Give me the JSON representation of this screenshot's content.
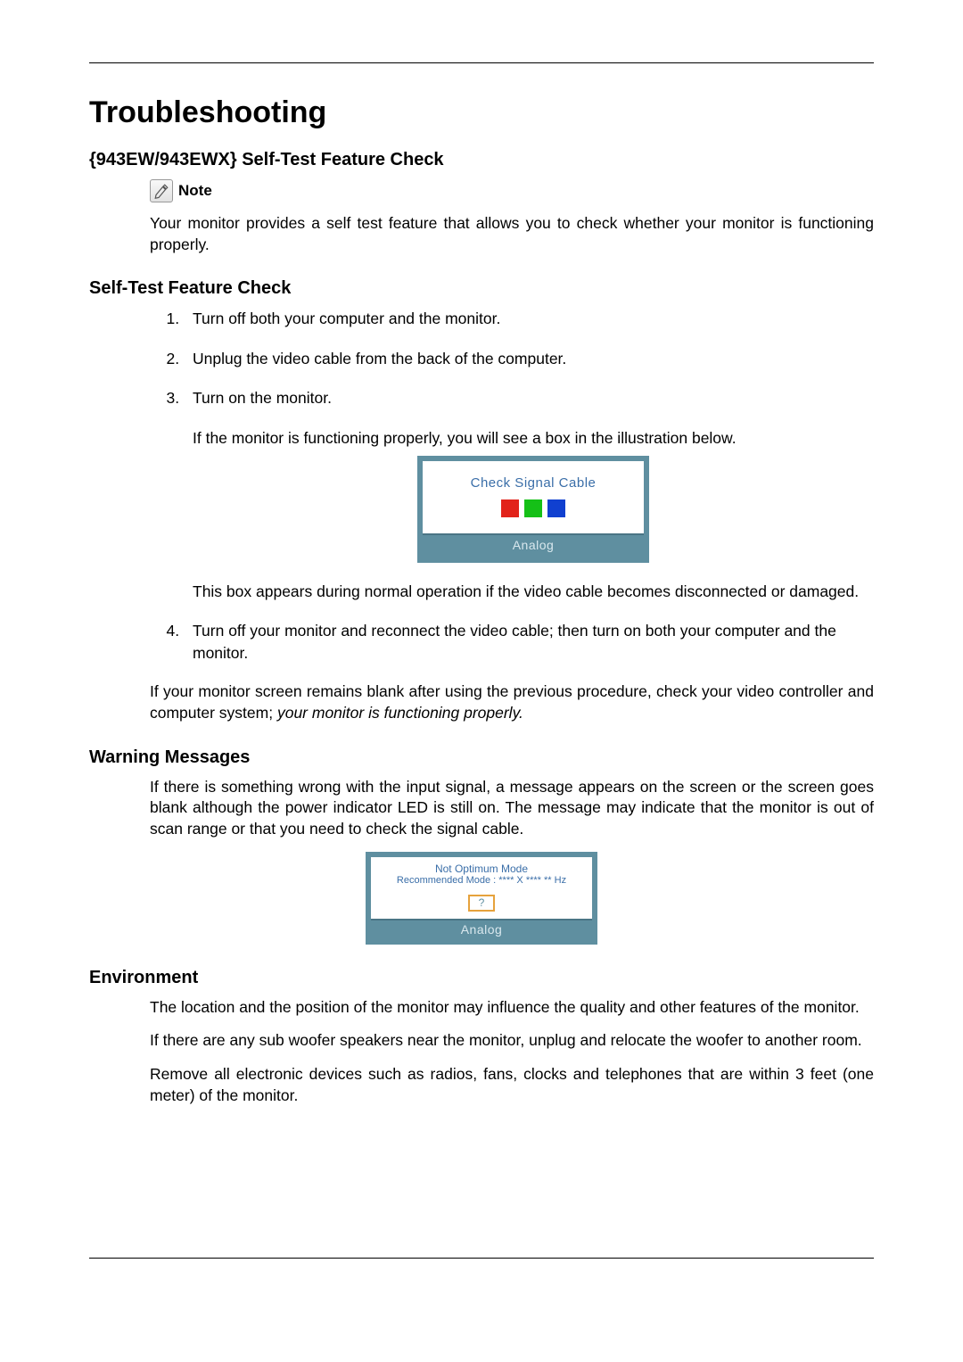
{
  "title": "Troubleshooting",
  "section1": {
    "heading": "{943EW/943EWX} Self-Test Feature Check",
    "note_label": "Note",
    "note_text": "Your monitor provides a self test feature that allows you to check whether your monitor is functioning properly."
  },
  "section2": {
    "heading": "Self-Test Feature Check",
    "steps": {
      "s1": "Turn off both your computer and the monitor.",
      "s2": "Unplug the video cable from the back of the computer.",
      "s3": "Turn on the monitor.",
      "s3_sub": "If the monitor is functioning properly, you will see a box in the illustration below.",
      "s3_after": "This box appears during normal operation if the video cable becomes disconnected or damaged.",
      "s4": "Turn off your monitor and reconnect the video cable; then turn on both your computer and the monitor."
    },
    "closing_plain": "If your monitor screen remains blank after using the previous procedure, check your video controller and computer system; ",
    "closing_em": "your monitor is functioning properly.",
    "osd1": {
      "message": "Check Signal Cable",
      "footer": "Analog"
    }
  },
  "section3": {
    "heading": "Warning Messages",
    "text": "If there is something wrong with the input signal, a message appears on the screen or the screen goes blank although the power indicator LED is still on. The message may indicate that the monitor is out of scan range or that you need to check the signal cable.",
    "osd2": {
      "line1": "Not Optimum Mode",
      "line2": "Recommended Mode : **** X **** ** Hz",
      "btn": "?",
      "footer": "Analog"
    }
  },
  "section4": {
    "heading": "Environment",
    "p1": "The location and the position of the monitor may influence the quality and other features of the monitor.",
    "p2": "If there are any sub woofer speakers near the monitor, unplug and relocate the woofer to another room.",
    "p3": "Remove all electronic devices such as radios, fans, clocks and telephones that are within 3 feet (one meter) of the monitor."
  }
}
